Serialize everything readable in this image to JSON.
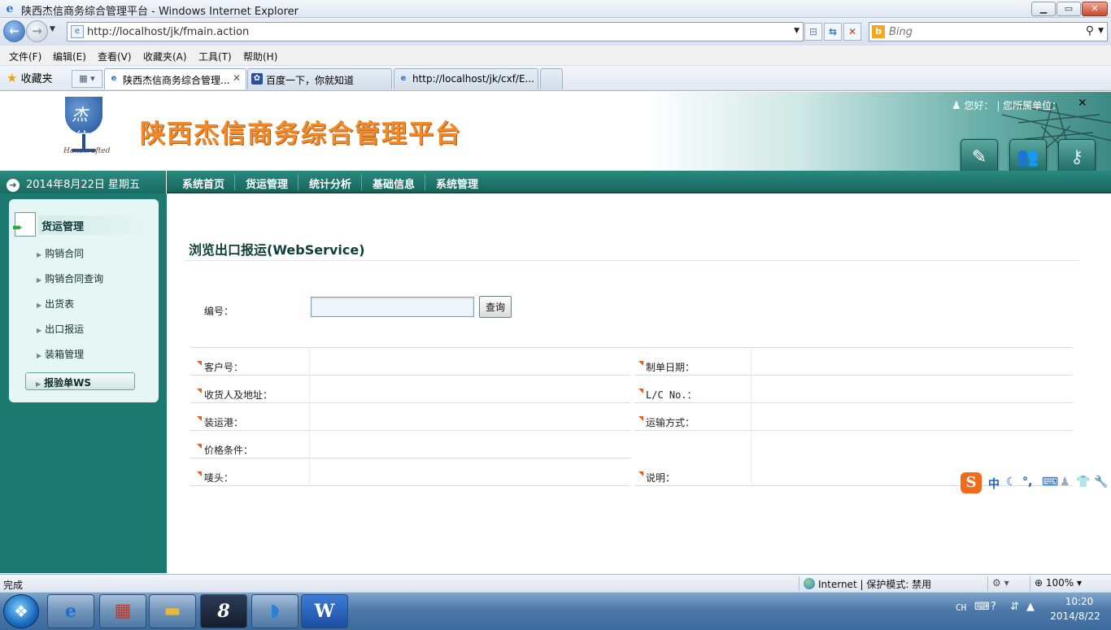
{
  "window": {
    "title": "陕西杰信商务综合管理平台 - Windows Internet Explorer",
    "min_label": "▁",
    "max_label": "▭",
    "close_label": "✕"
  },
  "address_bar": {
    "url": "http://localhost/jk/fmain.action",
    "search_placeholder": "Bing"
  },
  "menu": [
    "文件(F)",
    "编辑(E)",
    "查看(V)",
    "收藏夹(A)",
    "工具(T)",
    "帮助(H)"
  ],
  "favorites": {
    "label": "收藏夹"
  },
  "tabs": [
    {
      "label": "陕西杰信商务综合管理..."
    },
    {
      "label": "百度一下，你就知道"
    },
    {
      "label": "http://localhost/jk/cxf/E..."
    }
  ],
  "header": {
    "platform_title": "陕西杰信商务综合管理平台",
    "logo_glyph": "杰信",
    "logo_script": "Handcrafted",
    "greeting": "您好：",
    "unit_label": "| 您所属单位：",
    "close": "✕"
  },
  "datebar": {
    "date": "2014年8月22日 星期五"
  },
  "topnav": [
    "系统首页",
    "货运管理",
    "统计分析",
    "基础信息",
    "系统管理"
  ],
  "sidebar": {
    "heading": "货运管理",
    "items": [
      "购销合同",
      "购销合同查询",
      "出货表",
      "出口报运",
      "装箱管理"
    ],
    "active": "报验单WS"
  },
  "main": {
    "section_title": "浏览出口报运(WebService)",
    "search_label": "编号：",
    "search_value": "",
    "query_button": "查询",
    "fields": {
      "customer_no": "客户号：",
      "create_date": "制单日期：",
      "consignee": "收货人及地址：",
      "lc_no": "L/C No.：",
      "shipment_port": "装运港：",
      "transport": "运输方式：",
      "price_condition": "价格条件：",
      "marks": "唛头：",
      "remark": "说明："
    }
  },
  "ime": {
    "logo": "S",
    "mode": "中"
  },
  "statusbar": {
    "text": "完成",
    "zone": "Internet | 保护模式: 禁用",
    "zoom": "100%"
  },
  "taskbar": {
    "lang": "CH",
    "time": "10:20",
    "date": "2014/8/22"
  },
  "colors": {
    "teal_dark": "#16655c",
    "teal": "#1c7a70",
    "title_orange": "#f08a2a",
    "marker": "#e0602a"
  }
}
